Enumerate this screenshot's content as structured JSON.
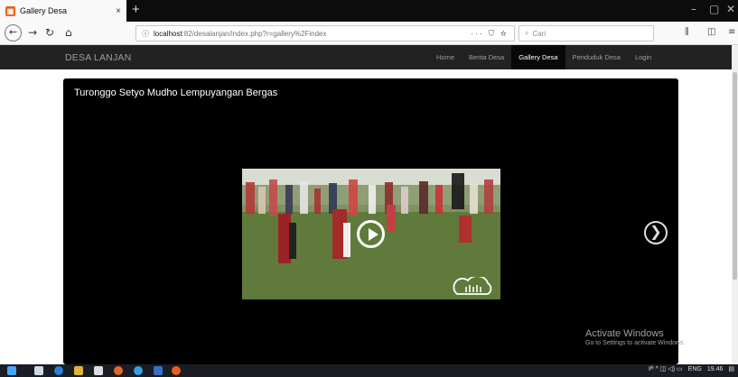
{
  "browser": {
    "tab_title": "Gallery Desa",
    "tab_close": "×",
    "new_tab": "+",
    "url_host": "localhost",
    "url_path": ":82/desalanjan/index.php?r=gallery%2Findex",
    "url_actions": "··· ⛉ ☆",
    "search_placeholder": "Cari",
    "window_controls": {
      "minimize": "–",
      "maximize": "▢",
      "close": "✕"
    }
  },
  "site": {
    "brand": "DESA LANJAN",
    "menu": [
      {
        "label": "Home",
        "active": false
      },
      {
        "label": "Berita Desa",
        "active": false
      },
      {
        "label": "Gallery Desa",
        "active": true
      },
      {
        "label": "Penduduk Desa",
        "active": false
      },
      {
        "label": "Login",
        "active": false
      }
    ]
  },
  "gallery": {
    "title": "Turonggo Setyo Mudho Lempuyangan Bergas",
    "next_glyph": "❯"
  },
  "watermark": {
    "title": "Activate Windows",
    "subtitle": "Go to Settings to activate Windows."
  },
  "taskbar": {
    "tray": "ENG",
    "time": "19.46"
  },
  "colors": {
    "header_bg": "#222222",
    "menu_active_bg": "#080808",
    "gallery_bg": "#000000"
  }
}
